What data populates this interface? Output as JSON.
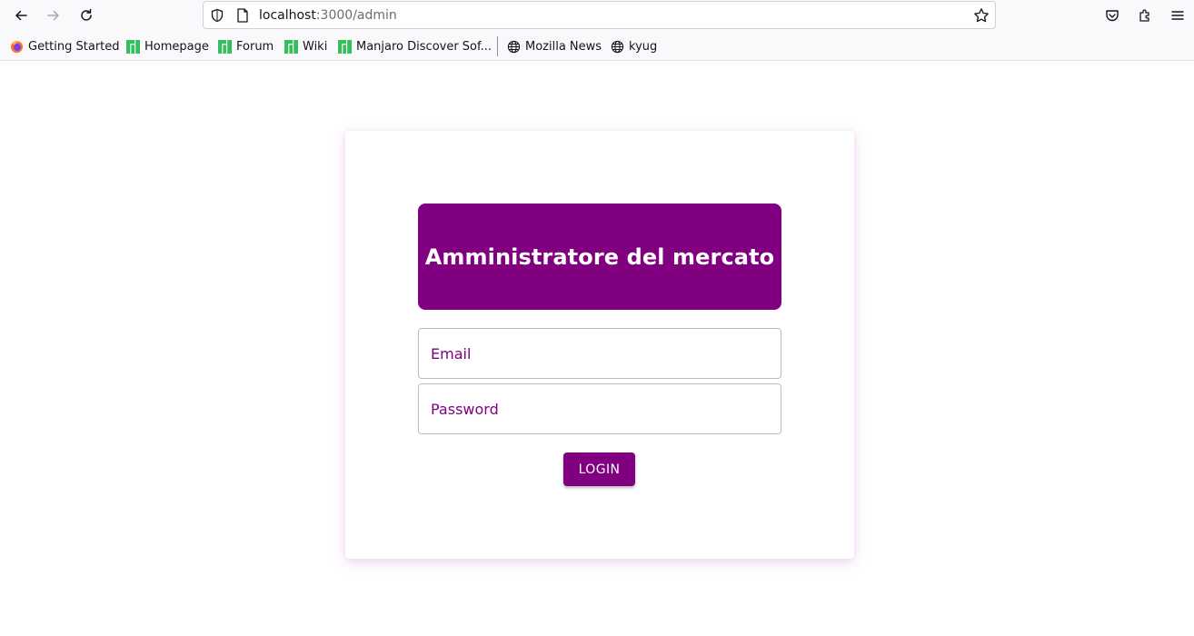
{
  "browser": {
    "url_host": "localhost",
    "url_path": ":3000/admin",
    "icons": [
      "back-arrow-icon",
      "forward-arrow-icon",
      "reload-icon",
      "shield-icon",
      "page-icon",
      "bookmark-star-icon",
      "pocket-icon",
      "extensions-icon",
      "menu-icon"
    ]
  },
  "bookmarks": [
    {
      "label": "Getting Started",
      "icon": "firefox-icon"
    },
    {
      "label": "Homepage",
      "icon": "manjaro-icon"
    },
    {
      "label": "Forum",
      "icon": "manjaro-icon"
    },
    {
      "label": "Wiki",
      "icon": "manjaro-icon"
    },
    {
      "label": "Manjaro Discover Sof...",
      "icon": "manjaro-icon"
    },
    {
      "label": "Mozilla News",
      "icon": "globe-icon"
    },
    {
      "label": "kyug",
      "icon": "globe-icon"
    }
  ],
  "login": {
    "title": "Amministratore del mercato",
    "email_placeholder": "Email",
    "password_placeholder": "Password",
    "login_label": "LOGIN"
  },
  "colors": {
    "accent": "#800080",
    "manjaro_green": "#35bf5c",
    "chrome_bg": "#f9f9fb"
  }
}
